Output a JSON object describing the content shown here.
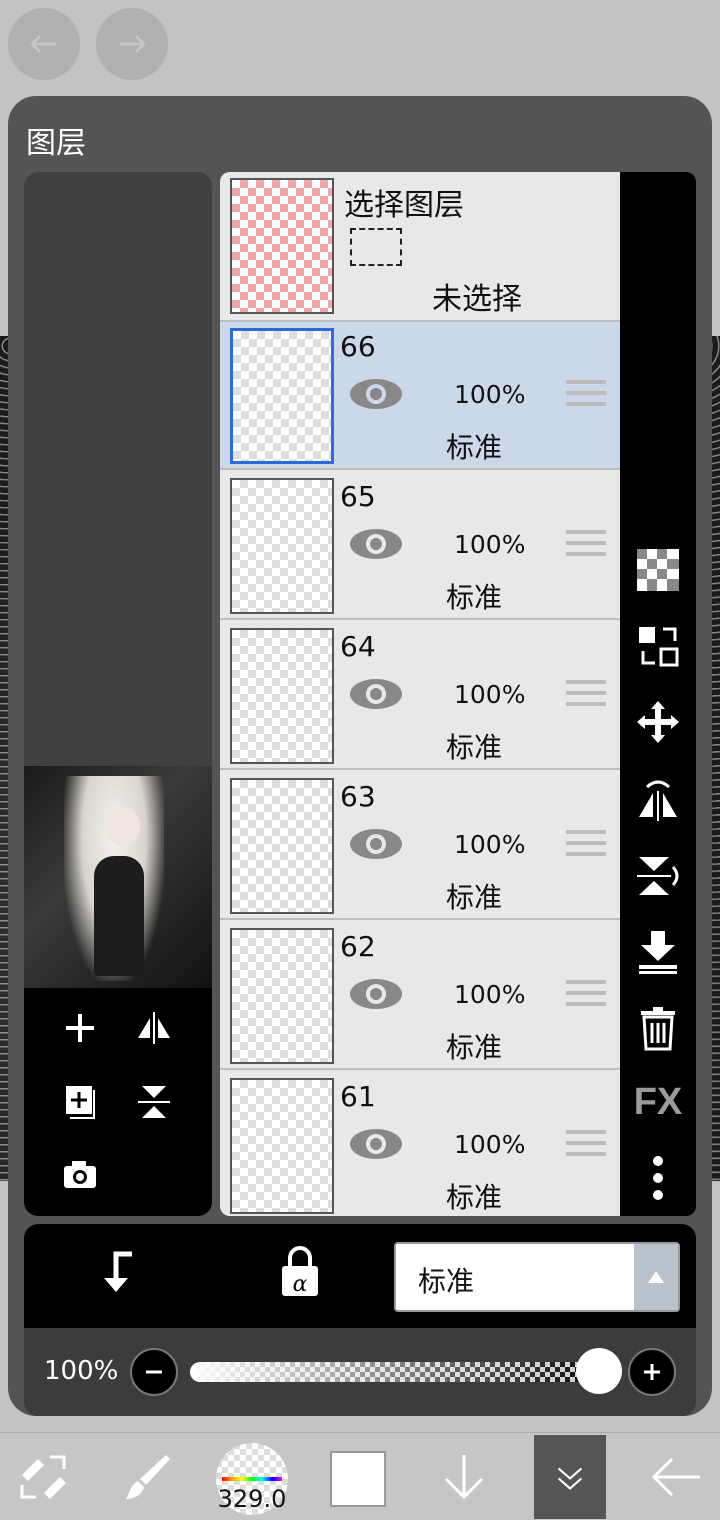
{
  "header": {
    "undo_icon": "undo-arrow-icon",
    "redo_icon": "redo-arrow-icon"
  },
  "panel": {
    "title": "图层"
  },
  "selection_layer": {
    "title": "选择图层",
    "state": "未选择"
  },
  "layers": [
    {
      "number": "66",
      "opacity": "100%",
      "blend": "标准",
      "visible": true,
      "selected": true
    },
    {
      "number": "65",
      "opacity": "100%",
      "blend": "标准",
      "visible": true,
      "selected": false
    },
    {
      "number": "64",
      "opacity": "100%",
      "blend": "标准",
      "visible": true,
      "selected": false
    },
    {
      "number": "63",
      "opacity": "100%",
      "blend": "标准",
      "visible": true,
      "selected": false
    },
    {
      "number": "62",
      "opacity": "100%",
      "blend": "标准",
      "visible": true,
      "selected": false
    },
    {
      "number": "61",
      "opacity": "100%",
      "blend": "标准",
      "visible": true,
      "selected": false
    }
  ],
  "right_tools": [
    "transparency-icon",
    "swap-layer-icon",
    "move-icon",
    "flip-horizontal-icon",
    "flip-vertical-icon",
    "merge-down-icon",
    "trash-icon",
    "fx-label",
    "more-icon"
  ],
  "right_fx_label": "FX",
  "left_tools": [
    "add-layer-icon",
    "flip-horizontal-icon",
    "add-layer-copy-icon",
    "flip-vertical-icon",
    "camera-icon"
  ],
  "bottom": {
    "blend_mode": "标准",
    "opacity_label": "100%",
    "opacity_value": 1.0
  },
  "toolbar": {
    "brush_size": "329.0",
    "color": "#ffffff"
  },
  "colors": {
    "selected_row": "#cbd8ea",
    "accent": "#2e6ad8",
    "panel": "#545454"
  }
}
